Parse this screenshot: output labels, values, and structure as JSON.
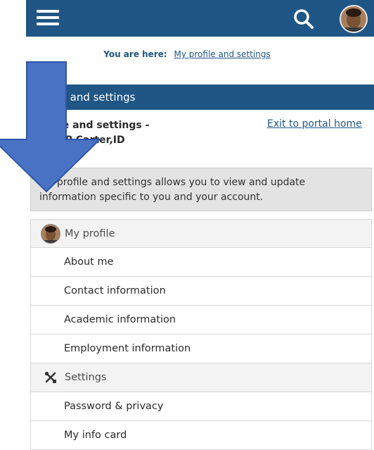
{
  "colors": {
    "brand": "#1f5685",
    "arrow": "#4a72c4",
    "info_bg": "#e3e3e3"
  },
  "topbar": {
    "menu_icon": "hamburger-icon",
    "search_icon": "search-icon",
    "avatar_icon": "user-avatar"
  },
  "breadcrumb": {
    "label": "You are here:",
    "link": "My profile and settings"
  },
  "section": {
    "title": "rofile and settings"
  },
  "page_heading": {
    "line1": "rofile and settings -",
    "line2": "Ann P Carter,ID"
  },
  "exit_link": "Exit to portal home",
  "info_text": "My profile and settings allows you to view and update information specific to you and your account.",
  "menu": {
    "profile_group": {
      "label": "My profile",
      "icon": "user-avatar"
    },
    "profile_items": [
      "About me",
      "Contact information",
      "Academic information",
      "Employment information"
    ],
    "settings_group": {
      "label": "Settings",
      "icon": "tools-icon"
    },
    "settings_items": [
      "Password & privacy",
      "My info card"
    ]
  }
}
